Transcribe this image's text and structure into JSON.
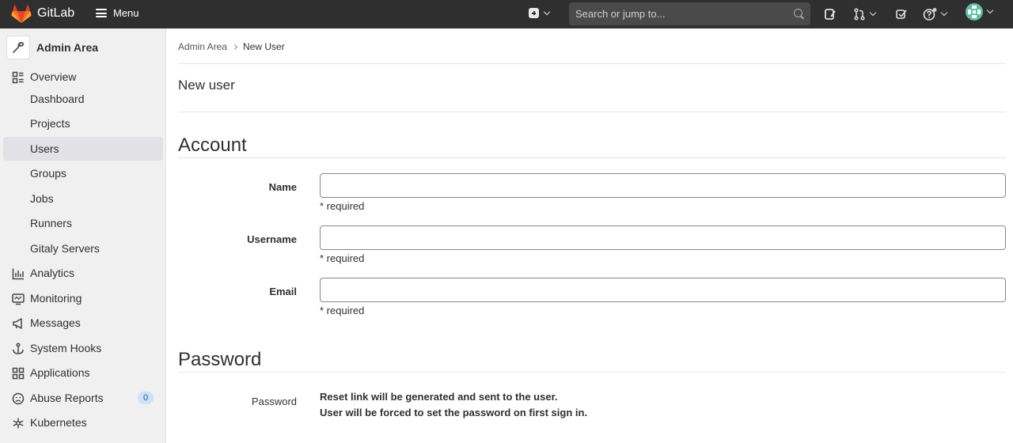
{
  "topbar": {
    "brand": "GitLab",
    "menu_label": "Menu",
    "search_placeholder": "Search or jump to..."
  },
  "sidebar": {
    "title": "Admin Area",
    "items": [
      {
        "label": "Overview",
        "icon": "overview-icon"
      },
      {
        "label": "Dashboard"
      },
      {
        "label": "Projects"
      },
      {
        "label": "Users",
        "active": true
      },
      {
        "label": "Groups"
      },
      {
        "label": "Jobs"
      },
      {
        "label": "Runners"
      },
      {
        "label": "Gitaly Servers"
      },
      {
        "label": "Analytics",
        "icon": "analytics-icon"
      },
      {
        "label": "Monitoring",
        "icon": "monitoring-icon"
      },
      {
        "label": "Messages",
        "icon": "messages-icon"
      },
      {
        "label": "System Hooks",
        "icon": "system-hooks-icon"
      },
      {
        "label": "Applications",
        "icon": "applications-icon"
      },
      {
        "label": "Abuse Reports",
        "icon": "abuse-reports-icon",
        "badge": "0"
      },
      {
        "label": "Kubernetes",
        "icon": "kubernetes-icon"
      }
    ]
  },
  "breadcrumb": {
    "parent": "Admin Area",
    "current": "New User"
  },
  "page": {
    "title": "New user"
  },
  "account": {
    "section_title": "Account",
    "fields": [
      {
        "label": "Name",
        "value": "",
        "hint": "* required"
      },
      {
        "label": "Username",
        "value": "",
        "hint": "* required"
      },
      {
        "label": "Email",
        "value": "",
        "hint": "* required"
      }
    ]
  },
  "password": {
    "section_title": "Password",
    "label": "Password",
    "line1": "Reset link will be generated and sent to the user.",
    "line2": "User will be forced to set the password on first sign in."
  },
  "colors": {
    "topbar_bg": "#2f2f2f",
    "sidebar_bg": "#f0f0f0",
    "active_item_bg": "#e1e1e6",
    "logo_orange": "#e24329"
  }
}
